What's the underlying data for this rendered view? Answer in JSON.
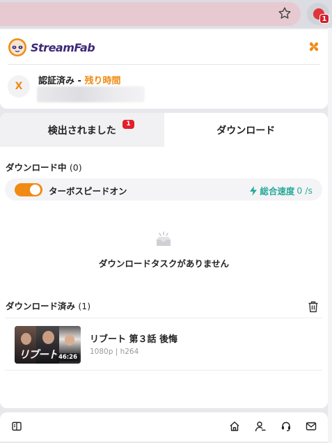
{
  "browser": {
    "extension_badge": "1"
  },
  "header": {
    "brand_name": "StreamFab",
    "avatar_letter": "X",
    "auth_status": "認証済み - ",
    "remaining_time_label": "残り時間"
  },
  "tabs": [
    {
      "label": "検出されました",
      "badge": "1"
    },
    {
      "label": "ダウンロード"
    }
  ],
  "downloading": {
    "title": "ダウンロード中",
    "count": "(0)",
    "turbo_label": "ターボスピードオン",
    "turbo_on": true,
    "speed_label": "総合速度",
    "speed_value": "0 /s",
    "empty_text": "ダウンロードタスクがありません"
  },
  "downloaded": {
    "title": "ダウンロード済み",
    "count": "(1)",
    "items": [
      {
        "title": "リブート 第３話 後悔",
        "meta": "1080p | h264",
        "duration": "46:26",
        "thumb_text": "リブート"
      }
    ]
  },
  "colors": {
    "accent_orange": "#f08a12",
    "speed_teal": "#27a99b",
    "brand_purple": "#3d2a78",
    "badge_red": "#e21f2b"
  },
  "icons": {
    "toolbar": [
      "star-icon",
      "extension-icon"
    ],
    "header": [
      "grid-icon"
    ],
    "footer": [
      "sidebar-panel-icon",
      "home-icon",
      "account-icon",
      "support-icon",
      "mail-icon"
    ]
  }
}
